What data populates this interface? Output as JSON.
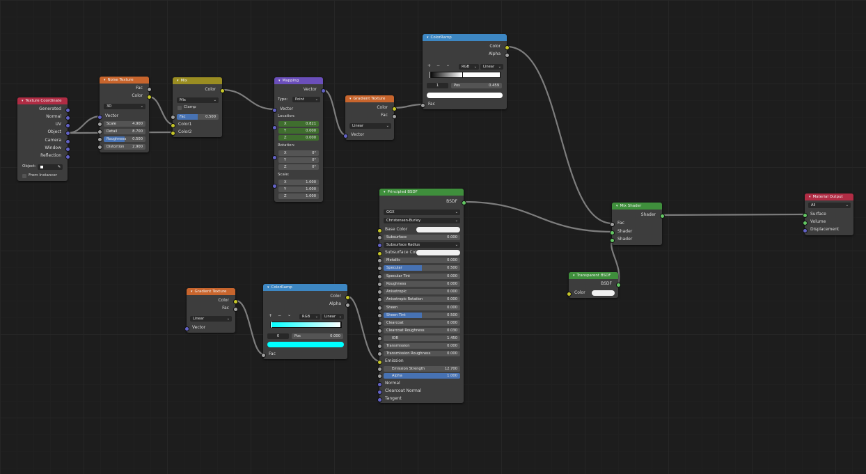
{
  "colors": {
    "header_input": "#b02c44",
    "header_texture": "#c8652d",
    "header_color": "#9a8d22",
    "header_vector": "#6b4fbb",
    "header_converter": "#3d87c3",
    "header_shader": "#3f8f3c",
    "header_output": "#b02c44",
    "link": "#8a8a8a",
    "socket_color": "#c7c729",
    "socket_float": "#a1a1a1",
    "socket_vector": "#6363c7",
    "socket_shader": "#63c763"
  },
  "texcoord": {
    "title": "Texture Coordinate",
    "outputs": [
      "Generated",
      "Normal",
      "UV",
      "Object",
      "Camera",
      "Window",
      "Reflection"
    ],
    "object_label": "Object:",
    "from_instancer": "From Instancer"
  },
  "noise": {
    "title": "Noise Texture",
    "out_fac": "Fac",
    "out_color": "Color",
    "dimensions": "3D",
    "in_vector": "Vector",
    "scale_label": "Scale",
    "scale_value": "4.900",
    "detail_label": "Detail",
    "detail_value": "8.700",
    "roughness_label": "Roughness",
    "roughness_value": "0.500",
    "roughness_fraction": 0.5,
    "distortion_label": "Distortion",
    "distortion_value": "2.900"
  },
  "mix": {
    "title": "Mix",
    "out_color": "Color",
    "blend_mode": "Mix",
    "clamp_label": "Clamp",
    "fac_label": "Fac",
    "fac_value": "0.500",
    "fac_fraction": 0.5,
    "in_color1": "Color1",
    "in_color2": "Color2"
  },
  "mapping": {
    "title": "Mapping",
    "out_vector": "Vector",
    "type_label": "Type:",
    "type_value": "Point",
    "in_vector": "Vector",
    "location_label": "Location:",
    "loc_x": "0.821",
    "loc_y": "0.000",
    "loc_z": "0.000",
    "rotation_label": "Rotation:",
    "rot_x": "0°",
    "rot_y": "0°",
    "rot_z": "0°",
    "scale_label": "Scale:",
    "scale_x": "1.000",
    "scale_y": "1.000",
    "scale_z": "1.000",
    "x": "X",
    "y": "Y",
    "z": "Z"
  },
  "gradient1": {
    "title": "Gradient Texture",
    "out_color": "Color",
    "out_fac": "Fac",
    "gradient_type": "Linear",
    "in_vector": "Vector"
  },
  "ramp1": {
    "title": "ColorRamp",
    "out_color": "Color",
    "out_alpha": "Alpha",
    "plus": "+",
    "minus": "−",
    "menu": "⌄",
    "color_mode": "RGB",
    "interpolation": "Linear",
    "index": "1",
    "pos_label": "Pos",
    "pos_value": "0.459",
    "stop_color": "#ffffff",
    "in_fac": "Fac"
  },
  "gradient2": {
    "title": "Gradient Texture",
    "out_color": "Color",
    "out_fac": "Fac",
    "gradient_type": "Linear",
    "in_vector": "Vector"
  },
  "ramp2": {
    "title": "ColorRamp",
    "out_color": "Color",
    "out_alpha": "Alpha",
    "plus": "+",
    "minus": "−",
    "menu": "⌄",
    "color_mode": "RGB",
    "interpolation": "Linear",
    "index": "0",
    "pos_label": "Pos",
    "pos_value": "0.000",
    "stop_color": "#00ffff",
    "in_fac": "Fac"
  },
  "principled": {
    "title": "Principled BSDF",
    "out_bsdf": "BSDF",
    "distribution": "GGX",
    "subsurface_method": "Christensen-Burley",
    "base_color_label": "Base Color",
    "subsurface_label": "Subsurface",
    "subsurface_value": "0.000",
    "subsurface_radius_label": "Subsurface Radius",
    "subsurface_color_label": "Subsurface Colo",
    "metallic_label": "Metallic",
    "metallic_value": "0.000",
    "specular_label": "Specular",
    "specular_value": "0.500",
    "specular_fraction": 0.5,
    "specular_tint_label": "Specular Tint",
    "specular_tint_value": "0.000",
    "roughness_label": "Roughness",
    "roughness_value": "0.000",
    "anisotropic_label": "Anisotropic",
    "anisotropic_value": "0.000",
    "anisotropic_rotation_label": "Anisotropic Rotation",
    "anisotropic_rotation_value": "0.000",
    "sheen_label": "Sheen",
    "sheen_value": "0.000",
    "sheen_tint_label": "Sheen Tint",
    "sheen_tint_value": "0.500",
    "sheen_tint_fraction": 0.5,
    "clearcoat_label": "Clearcoat",
    "clearcoat_value": "0.000",
    "clearcoat_roughness_label": "Clearcoat Roughness",
    "clearcoat_roughness_value": "0.030",
    "ior_label": "IOR",
    "ior_value": "1.450",
    "transmission_label": "Transmission",
    "transmission_value": "0.000",
    "transmission_roughness_label": "Transmission Roughness",
    "transmission_roughness_value": "0.000",
    "emission_label": "Emission",
    "emission_strength_label": "Emission Strength",
    "emission_strength_value": "12.700",
    "alpha_label": "Alpha",
    "alpha_value": "1.000",
    "alpha_fraction": 1.0,
    "normal_label": "Normal",
    "clearcoat_normal_label": "Clearcoat Normal",
    "tangent_label": "Tangent"
  },
  "mixshader": {
    "title": "Mix Shader",
    "out_shader": "Shader",
    "in_fac": "Fac",
    "in_shader1": "Shader",
    "in_shader2": "Shader"
  },
  "transparent": {
    "title": "Transparent BSDF",
    "out_bsdf": "BSDF",
    "in_color": "Color"
  },
  "output": {
    "title": "Material Output",
    "target": "All",
    "in_surface": "Surface",
    "in_volume": "Volume",
    "in_displacement": "Displacement"
  }
}
